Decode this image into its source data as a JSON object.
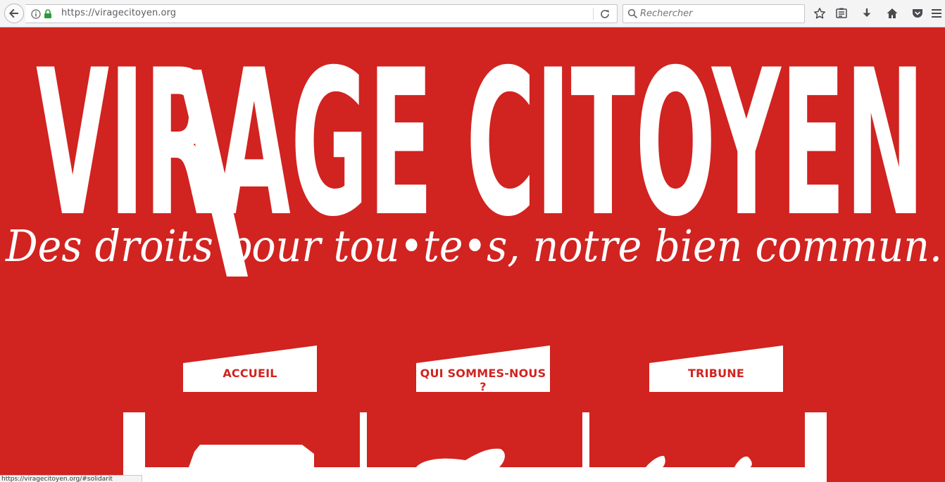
{
  "browser": {
    "url": "https://viragecitoyen.org",
    "search_placeholder": "Rechercher"
  },
  "site": {
    "title": "VIRAGE CITOYEN",
    "tagline": "Des droits pour tou•te•s, notre bien commun."
  },
  "nav": {
    "accueil": "ACCUEIL",
    "qui": "QUI SOMMES-NOUS ?",
    "tribune": "TRIBUNE"
  },
  "status_bar": {
    "link": "https://viragecitoyen.org/#solidarit"
  },
  "colors": {
    "brand_red": "#d12320",
    "white": "#ffffff"
  }
}
